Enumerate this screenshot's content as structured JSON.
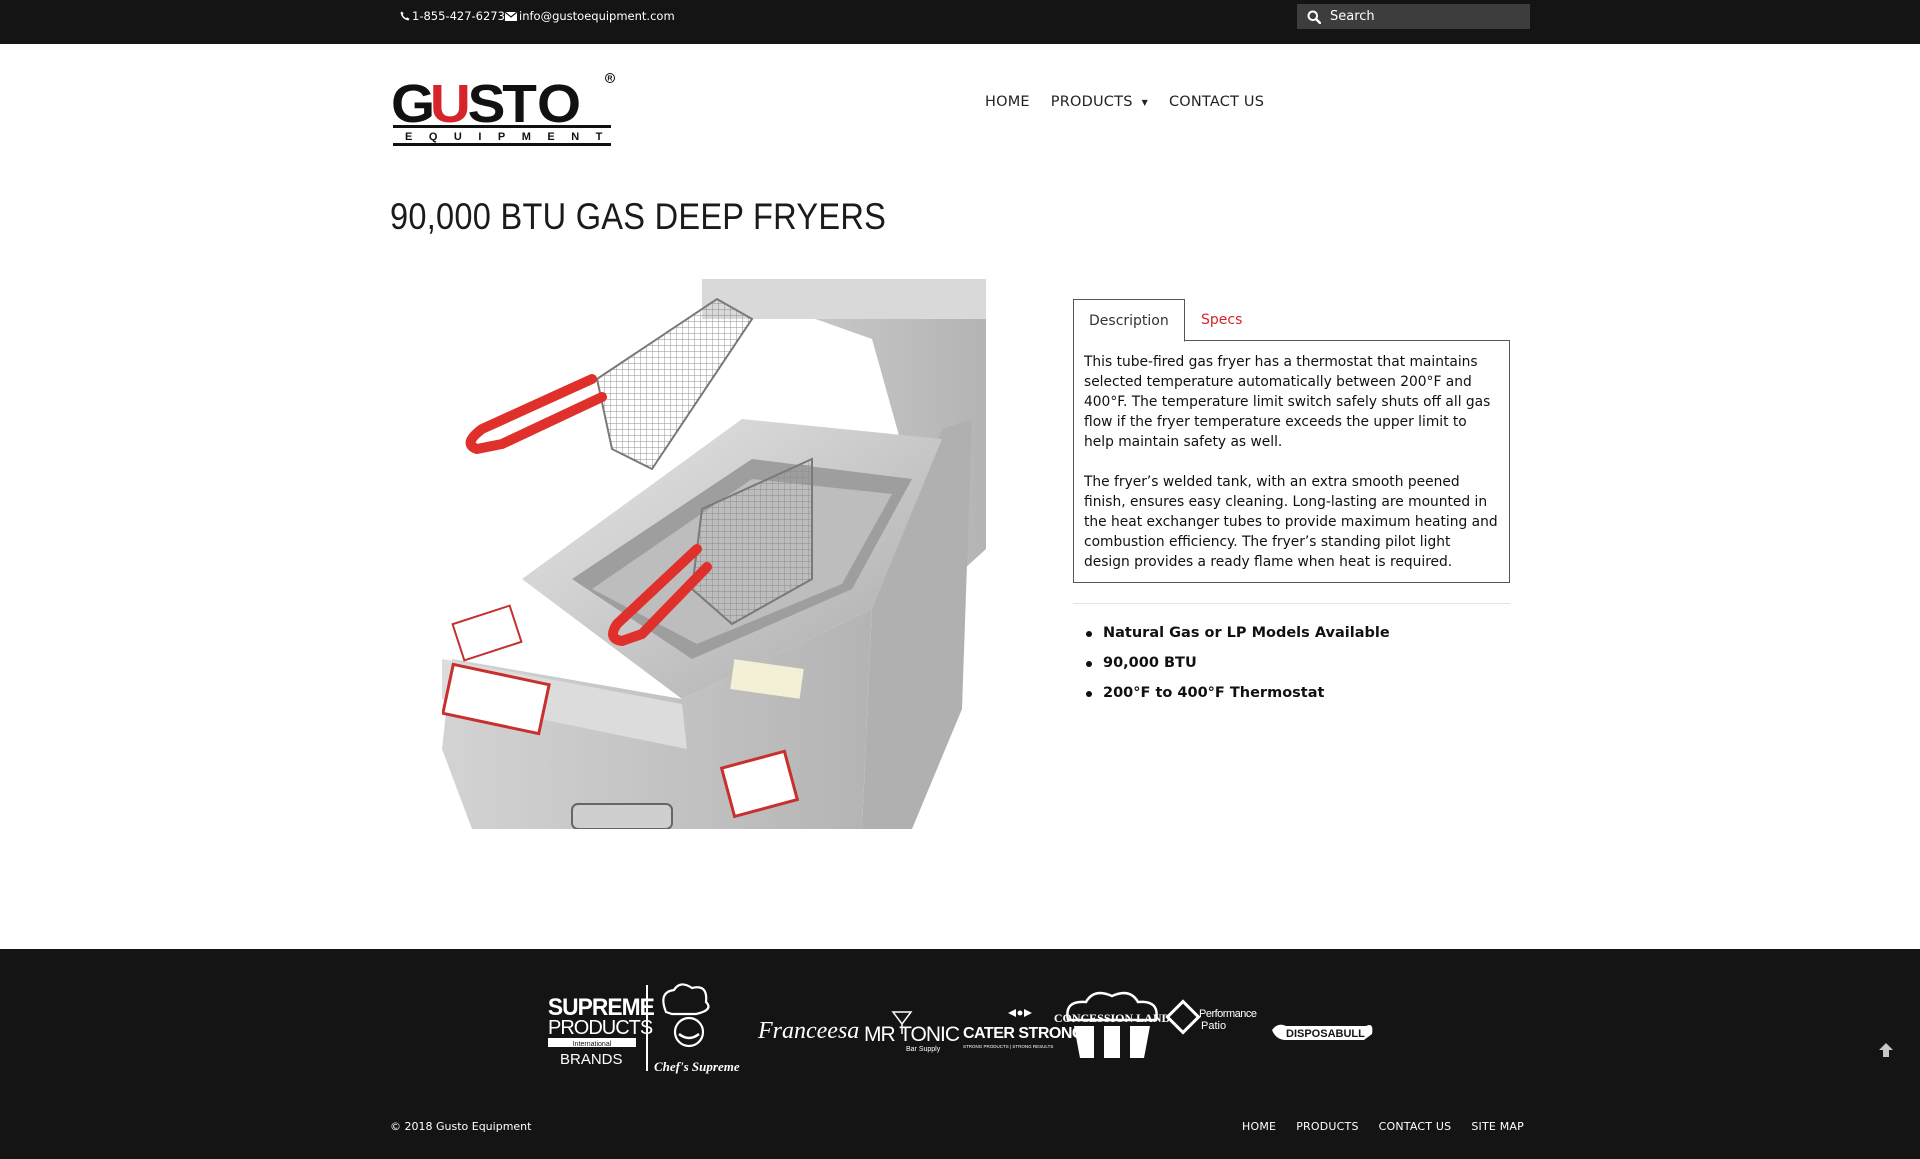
{
  "topbar": {
    "phone": "1-855-427-6273",
    "email": "info@gustoequipment.com",
    "search_placeholder": "Search",
    "phone_icon": "phone-icon",
    "email_icon": "envelope-icon",
    "search_icon": "search-icon"
  },
  "header": {
    "logo_text": "GUSTO",
    "logo_subtext": "EQUIPMENT",
    "nav": [
      {
        "label": "HOME"
      },
      {
        "label": "PRODUCTS",
        "has_dropdown": true
      },
      {
        "label": "CONTACT US"
      }
    ]
  },
  "main": {
    "title": "90,000 BTU GAS DEEP FRYERS",
    "tabs": [
      {
        "label": "Description",
        "active": true
      },
      {
        "label": "Specs",
        "active": false
      }
    ],
    "description": [
      "This tube-fired gas fryer has a thermostat that maintains selected temperature automatically between 200°F and 400°F. The temperature limit switch safely shuts off all gas flow if the fryer temperature exceeds the upper limit to help maintain safety as well.",
      "The fryer’s welded tank, with an extra smooth peened finish, ensures easy cleaning. Long-lasting are mounted in the heat exchanger tubes to provide maximum heating and combustion efficiency. The fryer’s standing pilot light design provides a ready flame when heat is required."
    ],
    "features": [
      "Natural Gas or LP Models Available",
      "90,000 BTU",
      "200°F to 400°F Thermostat"
    ]
  },
  "footer": {
    "brands": {
      "supreme_1": "SUPREME",
      "supreme_2": "PRODUCTS",
      "supreme_3": "International",
      "supreme_4": "BRANDS",
      "chefs": "Chef's Supreme",
      "franceesa": "Franceesa",
      "mrtonic_1": "MR TONIC",
      "mrtonic_2": "Bar Supply",
      "cater": "CATER STRONG",
      "cater_sub": "STRONG PRODUCTS | STRONG RESULTS",
      "concession": "CONCESSION LAND",
      "performance_1": "Performance",
      "performance_2": "Patio",
      "disposa": "DISPOSABULL"
    },
    "copyright": "© 2018 Gusto Equipment",
    "nav": [
      "HOME",
      "PRODUCTS",
      "CONTACT US",
      "SITE MAP"
    ],
    "to_top_icon": "arrow-up-icon"
  },
  "colors": {
    "topbar_bg": "#141414",
    "accent_red": "#d6242a",
    "footer_bg": "#141414"
  }
}
